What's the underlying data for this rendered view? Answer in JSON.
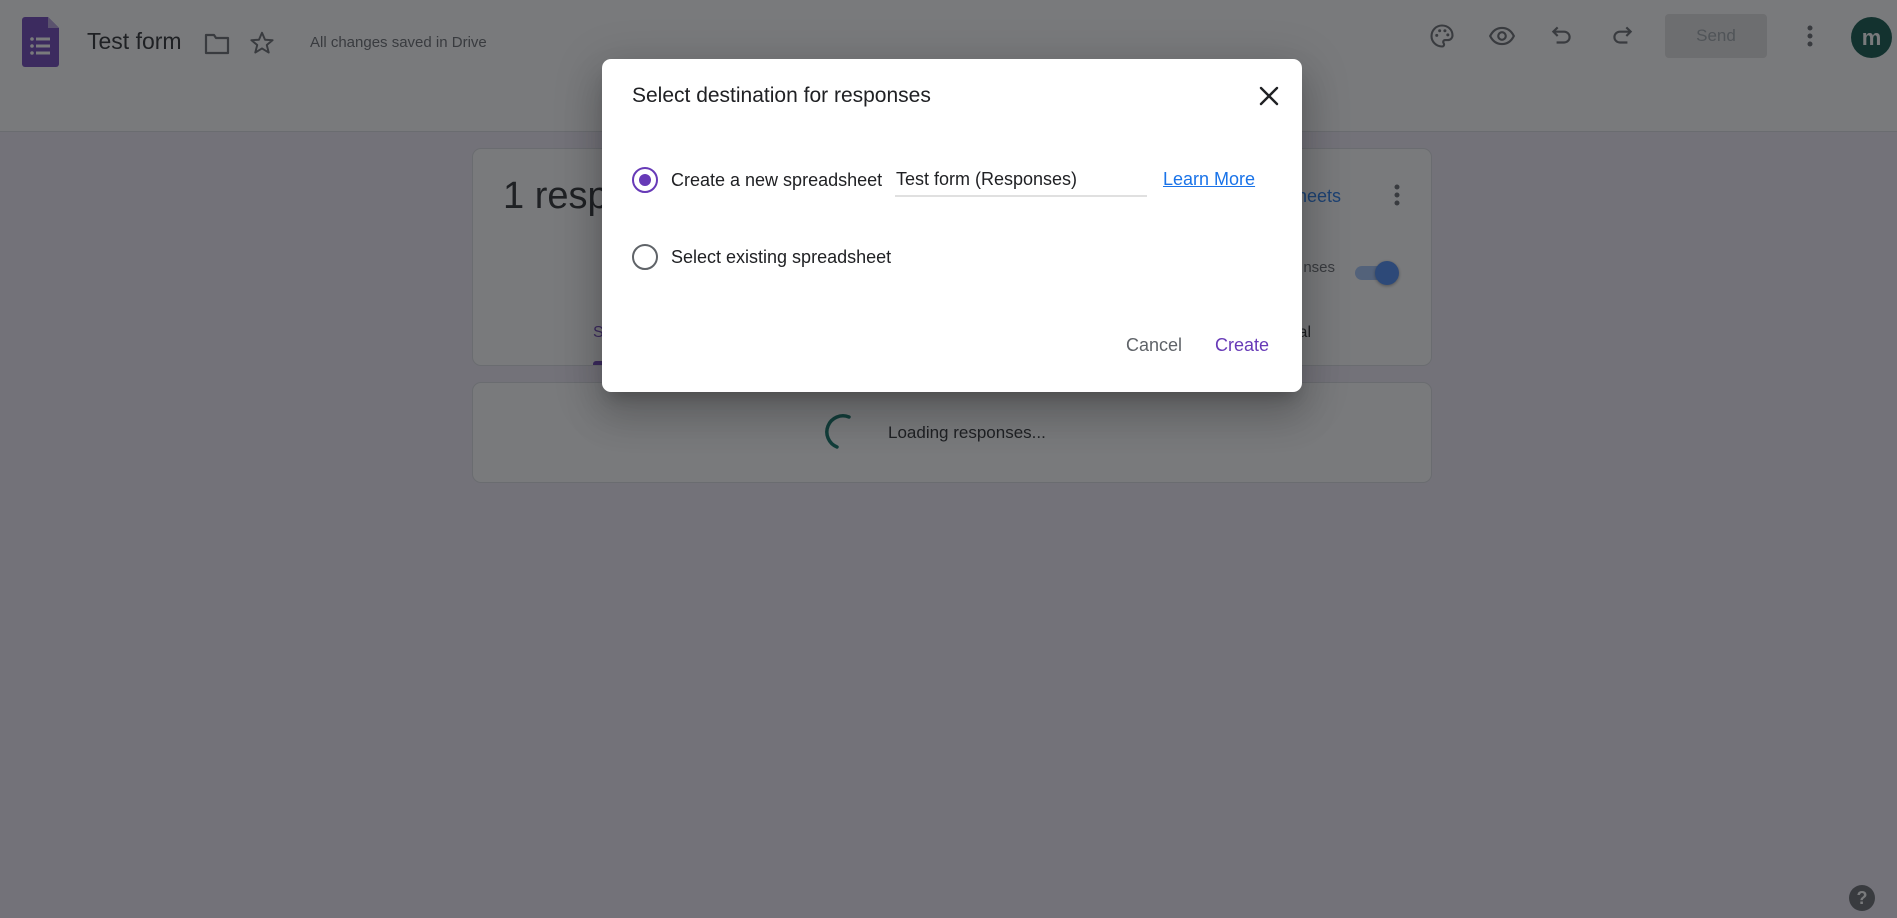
{
  "app": {
    "title": "Test form",
    "save_status": "All changes saved in Drive",
    "send_label": "Send",
    "avatar_initial": "m",
    "icons": [
      "forms-logo-icon",
      "folder-icon",
      "star-icon",
      "palette-icon",
      "preview-eye-icon",
      "undo-icon",
      "redo-icon",
      "more-vert-icon"
    ],
    "help_glyph": "?"
  },
  "responses_card": {
    "count_text": "1 respo",
    "sheets_link_partial": "heets",
    "accepting_label_partial": "nses",
    "accepting_responses": true,
    "tab_summary_partial": "S",
    "tab_individual_partial": "al"
  },
  "loading": {
    "text": "Loading responses..."
  },
  "dialog": {
    "title": "Select destination for responses",
    "options": [
      {
        "label": "Create a new spreadsheet",
        "selected": true
      },
      {
        "label": "Select existing spreadsheet",
        "selected": false
      }
    ],
    "spreadsheet_name_value": "Test form (Responses)",
    "learn_more_label": "Learn More",
    "cancel_label": "Cancel",
    "create_label": "Create"
  },
  "colors": {
    "accent": "#673ab7",
    "link": "#1a73e8",
    "avatar_bg": "#004d40"
  }
}
